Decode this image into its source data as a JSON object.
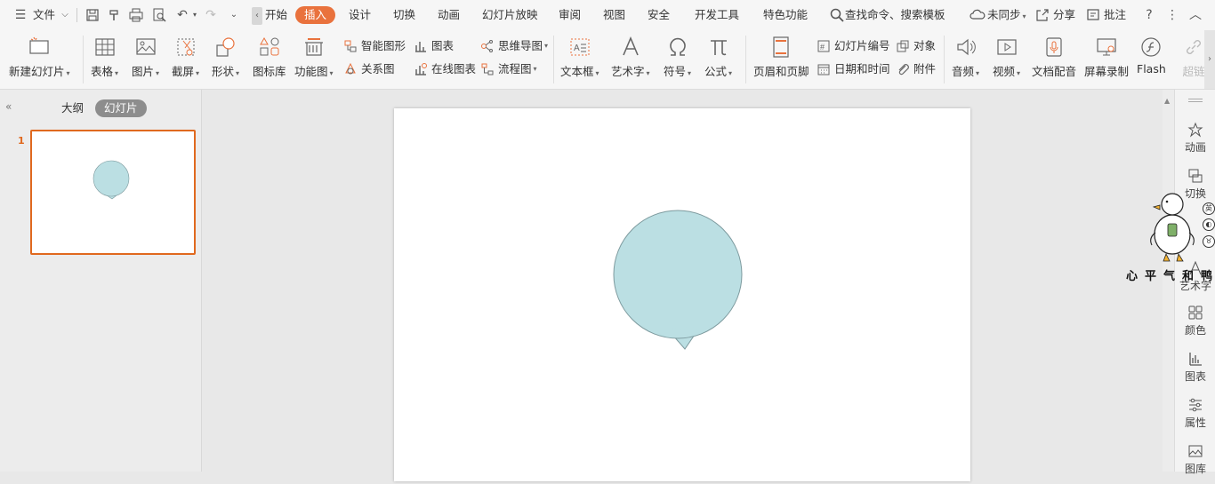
{
  "menubar": {
    "file_label": "文件",
    "tabs": [
      "开始",
      "插入",
      "设计",
      "切换",
      "动画",
      "幻灯片放映",
      "审阅",
      "视图",
      "安全",
      "开发工具",
      "特色功能"
    ],
    "active_tab": "插入",
    "search_label": "查找命令、搜索模板",
    "sync_label": "未同步",
    "share_label": "分享",
    "comment_label": "批注"
  },
  "ribbon": {
    "new_slide": "新建幻灯片",
    "table": "表格",
    "picture": "图片",
    "screenshot": "截屏",
    "shape": "形状",
    "icon_lib": "图标库",
    "func_chart": "功能图",
    "smart_art": "智能图形",
    "chart": "图表",
    "mind_map": "思维导图",
    "relation": "关系图",
    "online_chart": "在线图表",
    "flowchart": "流程图",
    "textbox": "文本框",
    "art_text": "艺术字",
    "symbol": "符号",
    "formula": "公式",
    "header_footer": "页眉和页脚",
    "slide_number": "幻灯片编号",
    "object": "对象",
    "date_time": "日期和时间",
    "attachment": "附件",
    "audio": "音频",
    "video": "视频",
    "doc_voice": "文档配音",
    "screen_rec": "屏幕录制",
    "flash": "Flash",
    "hyperlink": "超链"
  },
  "leftpanel": {
    "outline_tab": "大纲",
    "slides_tab": "幻灯片",
    "slide_number": "1"
  },
  "rightbar": {
    "items": [
      "动画",
      "切换",
      "艺术字",
      "颜色",
      "图表",
      "属性",
      "图库"
    ]
  },
  "watermark": {
    "text": "心平气和鸭",
    "badges": [
      "英",
      "◐",
      "♉"
    ]
  },
  "colors": {
    "accent": "#e9723d",
    "bubble_fill": "#bbdfe3",
    "bubble_stroke": "#7d9a9e",
    "thumb_border": "#e0691f"
  }
}
